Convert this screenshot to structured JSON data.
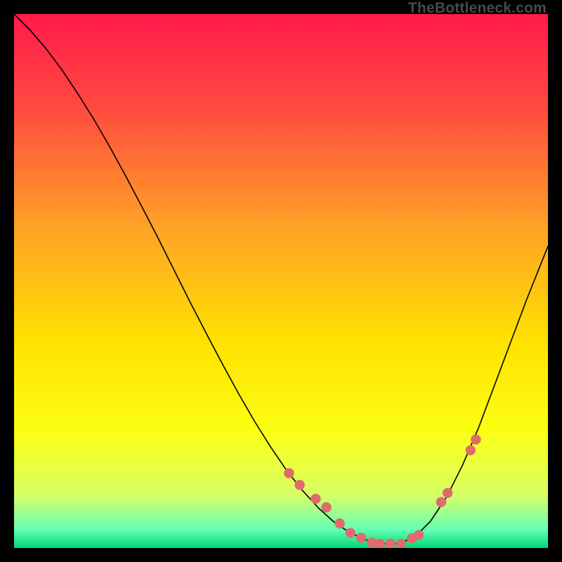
{
  "attribution": "TheBottleneck.com",
  "chart_data": {
    "type": "line",
    "title": "",
    "xlabel": "",
    "ylabel": "",
    "xlim": [
      0,
      100
    ],
    "ylim": [
      0,
      100
    ],
    "background_gradient": {
      "stops": [
        {
          "pos": 0.0,
          "color": "#ff1a4b"
        },
        {
          "pos": 0.18,
          "color": "#ff4b3f"
        },
        {
          "pos": 0.4,
          "color": "#ffa326"
        },
        {
          "pos": 0.62,
          "color": "#ffe300"
        },
        {
          "pos": 0.78,
          "color": "#fbff12"
        },
        {
          "pos": 0.9,
          "color": "#d9ff66"
        },
        {
          "pos": 0.965,
          "color": "#66ffb3"
        },
        {
          "pos": 1.0,
          "color": "#00d978"
        }
      ]
    },
    "series": [
      {
        "name": "curve",
        "color": "#000000",
        "width": 1.6,
        "x": [
          0,
          3,
          6,
          9,
          12,
          15,
          18,
          21,
          24,
          27,
          30,
          33,
          36,
          39,
          42,
          45,
          48,
          51,
          54,
          57,
          60,
          63,
          66,
          69,
          72,
          75,
          78,
          81,
          84,
          87,
          90,
          93,
          96,
          100
        ],
        "y": [
          100,
          97,
          93.5,
          89.5,
          85,
          80.2,
          75,
          69.5,
          63.8,
          58,
          52,
          46,
          40.2,
          34.5,
          29,
          23.8,
          19,
          14.6,
          10.8,
          7.5,
          4.8,
          2.8,
          1.5,
          0.8,
          0.8,
          2.0,
          5.0,
          9.5,
          15.5,
          22.5,
          30.5,
          38.5,
          46.5,
          56.5
        ]
      }
    ],
    "markers": {
      "name": "bead-points",
      "color": "#e06b6e",
      "radius": 7.2,
      "x": [
        51.5,
        53.5,
        56.5,
        58.5,
        61.0,
        63.0,
        65.0,
        67.0,
        68.5,
        70.5,
        72.5,
        74.5,
        75.8,
        80.0,
        81.2,
        85.5,
        86.5
      ],
      "y": [
        14.0,
        11.8,
        9.2,
        7.6,
        4.6,
        2.8,
        1.9,
        1.0,
        0.8,
        0.8,
        0.8,
        1.8,
        2.4,
        8.6,
        10.3,
        18.3,
        20.3
      ]
    }
  }
}
